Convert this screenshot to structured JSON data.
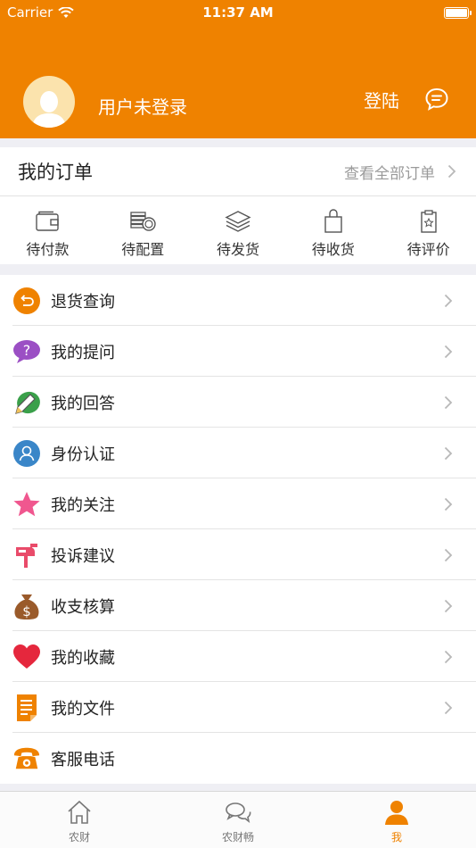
{
  "status_bar": {
    "carrier": "Carrier",
    "time": "11:37 AM",
    "battery_percent": 100
  },
  "profile": {
    "user_name": "用户未登录",
    "login_label": "登陆"
  },
  "orders": {
    "title": "我的订单",
    "view_all": "查看全部订单",
    "tabs": [
      {
        "label": "待付款",
        "icon": "wallet-icon"
      },
      {
        "label": "待配置",
        "icon": "coins-icon"
      },
      {
        "label": "待发货",
        "icon": "layers-icon"
      },
      {
        "label": "待收货",
        "icon": "bag-icon"
      },
      {
        "label": "待评价",
        "icon": "clipboard-star-icon"
      }
    ]
  },
  "menu": {
    "items": [
      {
        "label": "退货查询",
        "icon": "return-icon",
        "color": "#ef8200"
      },
      {
        "label": "我的提问",
        "icon": "question-bubble-icon",
        "color": "#9b4fc4"
      },
      {
        "label": "我的回答",
        "icon": "pen-bubble-icon",
        "color": "#3aa04a"
      },
      {
        "label": "身份认证",
        "icon": "identity-icon",
        "color": "#3a86c8"
      },
      {
        "label": "我的关注",
        "icon": "star-icon",
        "color": "#f0578f"
      },
      {
        "label": "投诉建议",
        "icon": "mailbox-icon",
        "color": "#e94b6a"
      },
      {
        "label": "收支核算",
        "icon": "money-bag-icon",
        "color": "#9a5a2a"
      },
      {
        "label": "我的收藏",
        "icon": "heart-icon",
        "color": "#e5273d"
      },
      {
        "label": "我的文件",
        "icon": "document-icon",
        "color": "#ef8200"
      },
      {
        "label": "客服电话",
        "icon": "telephone-icon",
        "color": "#ef8200"
      }
    ]
  },
  "tabbar": {
    "tabs": [
      {
        "label": "农财",
        "icon": "home-icon"
      },
      {
        "label": "农财畅",
        "icon": "chat-icon"
      },
      {
        "label": "我",
        "icon": "person-icon",
        "active": true
      }
    ],
    "active_color": "#ef8200"
  },
  "colors": {
    "brand": "#ef8200",
    "background": "#efeff4"
  }
}
